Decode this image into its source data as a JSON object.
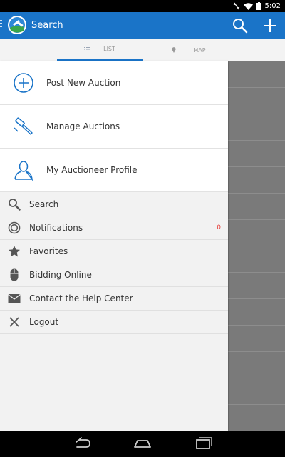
{
  "status_bar": {
    "time": "5:02"
  },
  "action_bar": {
    "title": "Search"
  },
  "tabs": [
    {
      "label": "LIST"
    },
    {
      "label": "MAP"
    }
  ],
  "drawer": {
    "primary_items": [
      {
        "label": "Post New Auction",
        "icon": "plus-circle-icon"
      },
      {
        "label": "Manage Auctions",
        "icon": "gavel-icon"
      },
      {
        "label": "My Auctioneer Profile",
        "icon": "person-icon"
      }
    ],
    "secondary_items": [
      {
        "label": "Search",
        "icon": "search-icon"
      },
      {
        "label": "Notifications",
        "icon": "target-icon",
        "badge": "0"
      },
      {
        "label": "Favorites",
        "icon": "star-icon"
      },
      {
        "label": "Bidding Online",
        "icon": "mouse-icon"
      },
      {
        "label": "Contact the Help Center",
        "icon": "envelope-icon"
      },
      {
        "label": "Logout",
        "icon": "close-icon"
      }
    ]
  },
  "colors": {
    "primary": "#1a74c8",
    "badge": "#e53935",
    "dimmed_content": "#7a7a7a"
  }
}
